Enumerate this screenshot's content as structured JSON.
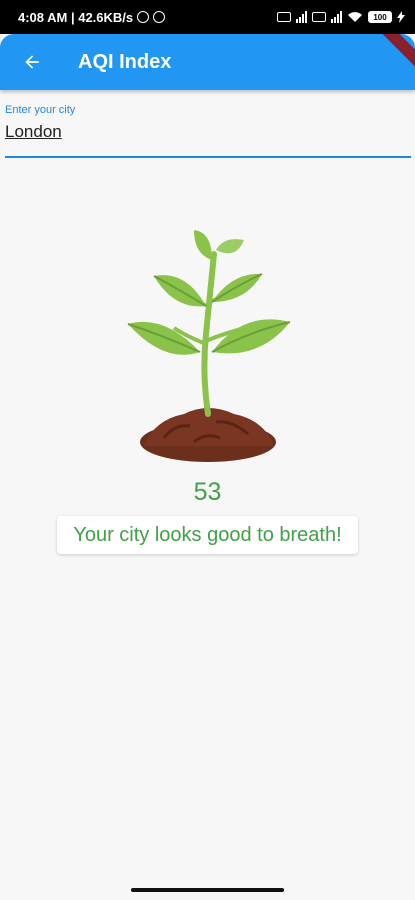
{
  "status_bar": {
    "time_speed": "4:08 AM | 42.6KB/s",
    "battery": "100"
  },
  "app_bar": {
    "title": "AQI Index",
    "back_icon": "arrow-left-icon"
  },
  "city_field": {
    "label": "Enter your city",
    "value": "London"
  },
  "aqi": {
    "value": "53",
    "message": "Your city looks good to breath!"
  },
  "colors": {
    "app_bar": "#2196f3",
    "accent_text": "#43a047",
    "field_accent": "#1e88e5"
  },
  "illustration": "plant-sprout-image"
}
